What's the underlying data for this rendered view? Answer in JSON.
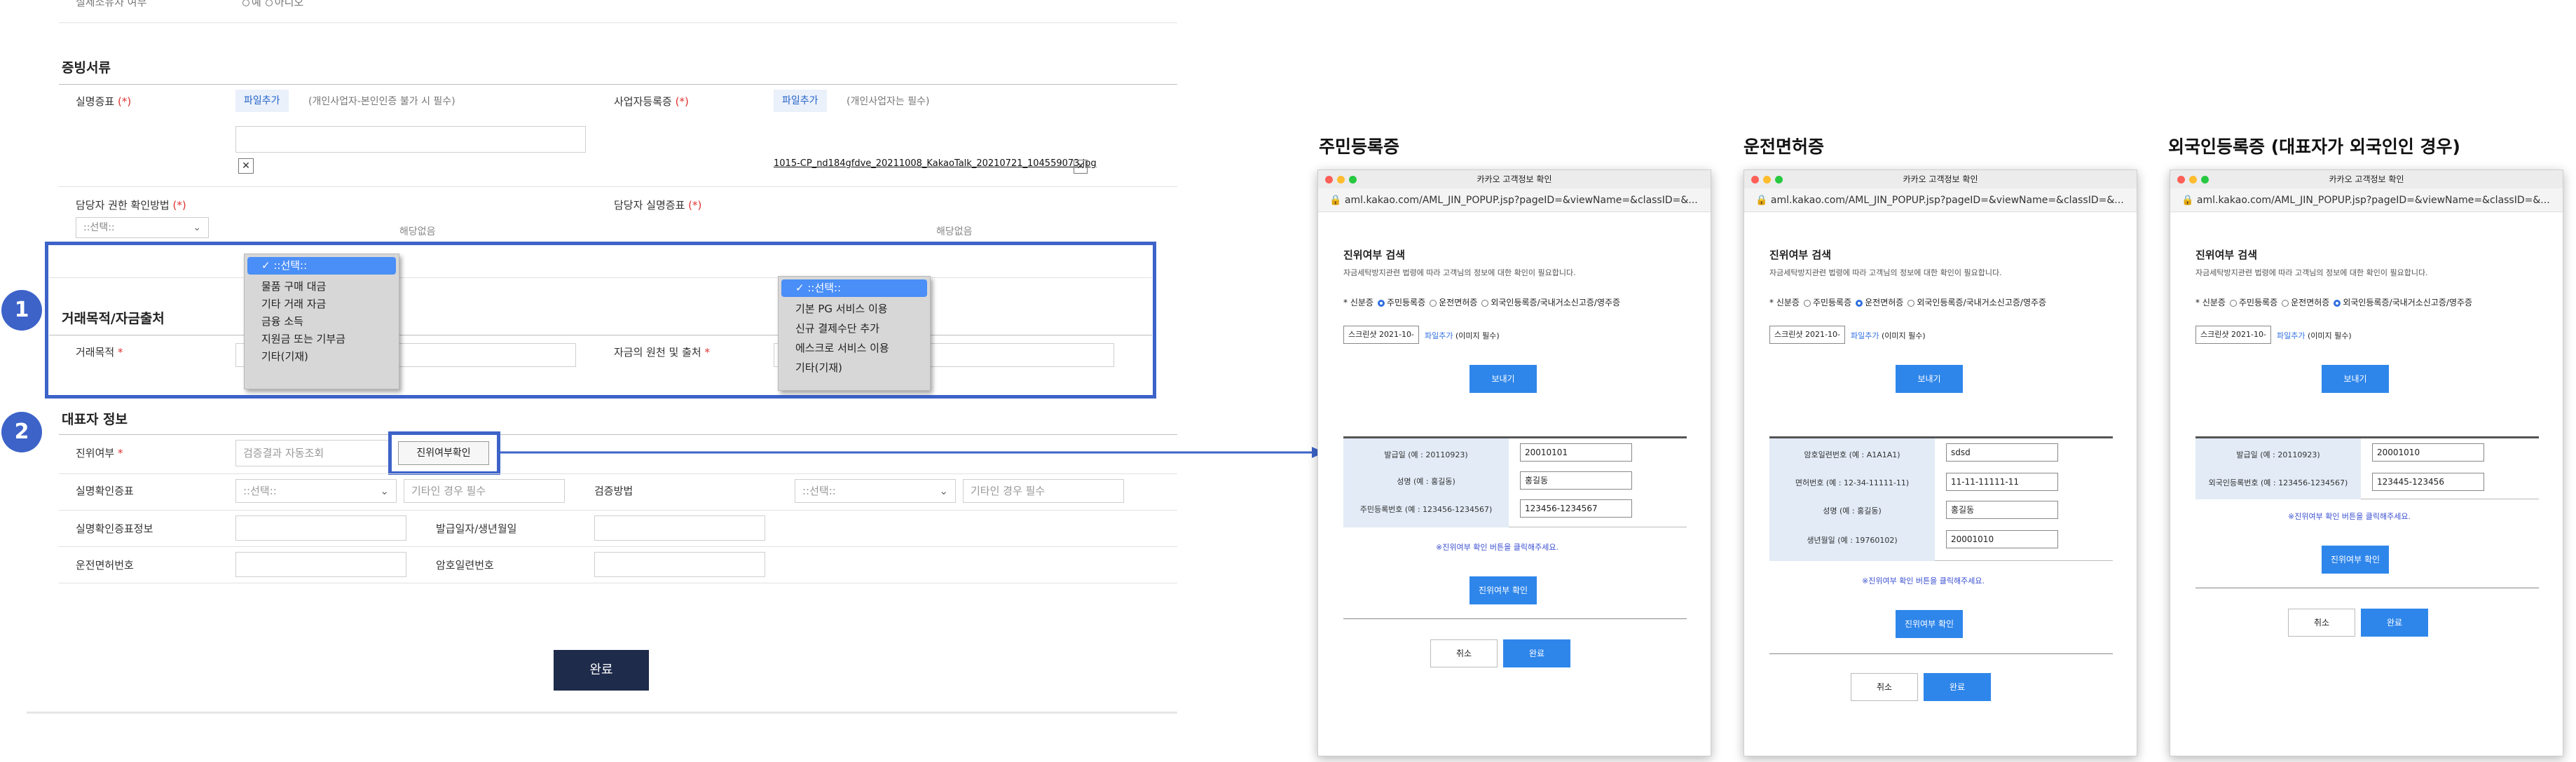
{
  "form": {
    "top_cut_label": "실제소유자 여부",
    "top_radio_yes": "예",
    "top_radio_no": "아니오",
    "evidence_section": "증빙서류",
    "real_name_label": "실명증표",
    "req_mark": "(*)",
    "file_add": "파일추가",
    "real_name_hint": "(개인사업자-본인인증 불가 시 필수)",
    "biz_reg_label": "사업자등록증",
    "biz_reg_hint": "(개인사업자는 필수)",
    "biz_file_name": "1015-CP_nd184gfdve_20211008_KakaoTalk_20210721_104559073.jpg",
    "remove_x": "✕",
    "auth_method_label": "담당자 권한 확인방법",
    "auth_select_placeholder": "::선택::",
    "not_applicable": "해당없음",
    "manager_id_label": "담당자 실명증표",
    "transaction_section": "거래목적/자금출처",
    "purpose_label": "거래목적",
    "fund_source_label": "자금의 원천 및 출처",
    "star": "*",
    "dropdown1": {
      "options": [
        "::선택::",
        "물품 구매 대금",
        "기타 거래 자금",
        "금융 소득",
        "지원금 또는 기부금",
        "기타(기재)"
      ],
      "selected_index": 0
    },
    "dropdown2": {
      "options": [
        "::선택::",
        "기본 PG 서비스 이용",
        "신규 결제수단 추가",
        "에스크로 서비스 이용",
        "기타(기재)"
      ],
      "selected_index": 0
    },
    "rep_section": "대표자 정보",
    "auth_label": "진위여부",
    "auth_value": "검증결과 자동조회",
    "auth_button": "진위여부확인",
    "real_id_doc_label": "실명확인증표",
    "real_id_select": "::선택::",
    "other_required": "기타인 경우 필수",
    "verify_method_label": "검증방법",
    "verify_select": "::선택::",
    "real_id_info_label": "실명확인증표정보",
    "issue_date_label": "발급일자/생년월일",
    "license_no_label": "운전면허번호",
    "cipher_no_label": "암호일련번호",
    "complete_button": "완료"
  },
  "badges": [
    "1",
    "2"
  ],
  "headings": [
    "주민등록증",
    "운전면허증",
    "외국인등록증 (대표자가 외국인인 경우)"
  ],
  "popup_common": {
    "window_title": "카카오 고객정보 확인",
    "url": "aml.kakao.com/AML_JIN_POPUP.jsp?pageID=&viewName=&classID=&...",
    "search_title": "진위여부 검색",
    "search_desc": "자금세탁방지관련 법령에 따라 고객님의 정보에 대한 확인이 필요합니다.",
    "id_type_label": "* 신분증",
    "opt_resident": "주민등록증",
    "opt_license": "운전면허증",
    "opt_foreign": "외국인등록증/국내거소신고증/영주증",
    "screenshot_btn": "스크린샷 2021-10-",
    "file_add": "파일추가",
    "image_required": "(이미지 필수)",
    "view_button": "보내기",
    "note": "※진위여부 확인 버튼을 클릭해주세요.",
    "check_button": "진위여부 확인",
    "cancel": "취소",
    "done": "완료"
  },
  "popup1": {
    "rows": [
      {
        "label": "발급일 (예 : 20110923)",
        "value": "20010101"
      },
      {
        "label": "성명 (예 : 홍길동)",
        "value": "홍길동"
      },
      {
        "label": "주민등록번호 (예 : 123456-1234567)",
        "value": "123456-1234567"
      }
    ]
  },
  "popup2": {
    "rows": [
      {
        "label": "암호일련번호 (예 : A1A1A1)",
        "value": "sdsd"
      },
      {
        "label": "면허번호 (예 : 12-34-11111-11)",
        "value": "11-11-11111-11"
      },
      {
        "label": "성명 (예 : 홍길동)",
        "value": "홍길동"
      },
      {
        "label": "생년월일 (예 : 19760102)",
        "value": "20001010"
      }
    ]
  },
  "popup3": {
    "rows": [
      {
        "label": "발급일 (예 : 20110923)",
        "value": "20001010"
      },
      {
        "label": "외국인등록번호 (예 : 123456-1234567)",
        "value": "123445-123456"
      }
    ]
  },
  "colors": {
    "accent": "#3d63c9",
    "popup_blue": "#2f86ea",
    "navy": "#1e2b4a"
  }
}
